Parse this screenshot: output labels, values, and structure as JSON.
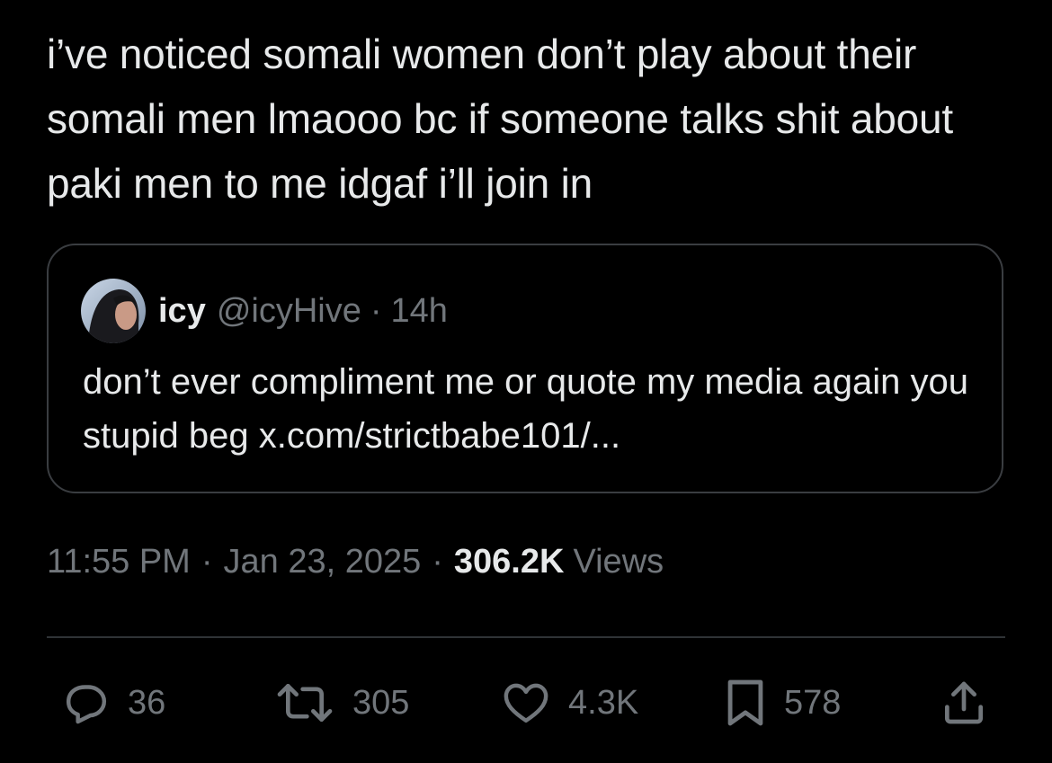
{
  "tweet": {
    "text": "i’ve noticed somali women don’t play about their somali men lmaooo bc if someone talks shit about paki men to me idgaf i’ll join in"
  },
  "quoted_tweet": {
    "name": "icy",
    "handle": "@icyHive",
    "separator": "·",
    "time": "14h",
    "text": "don’t ever compliment me or quote my media again you stupid beg x.com/strictbabe101/..."
  },
  "meta": {
    "time": "11:55 PM",
    "separator": "·",
    "date": "Jan 23, 2025",
    "views_count": "306.2K",
    "views_label": "Views"
  },
  "actions": {
    "replies": "36",
    "reposts": "305",
    "likes": "4.3K",
    "bookmarks": "578",
    "icons": [
      "reply-icon",
      "repost-icon",
      "like-icon",
      "bookmark-icon",
      "share-icon"
    ]
  },
  "colors": {
    "background": "#000000",
    "text_primary": "#e7e9ea",
    "text_secondary": "#71767b",
    "border": "#2f3336"
  }
}
